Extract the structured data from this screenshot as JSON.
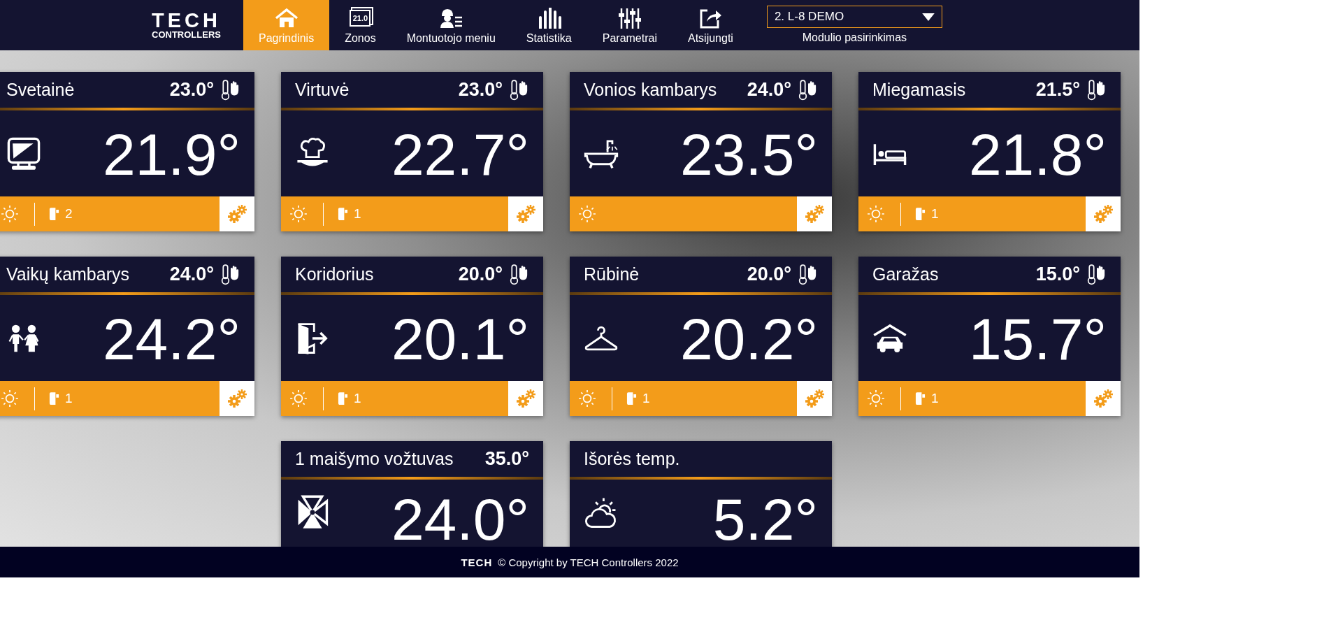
{
  "header": {
    "logo": {
      "brand": "TECH",
      "subtitle": "CONTROLLERS"
    },
    "nav": [
      {
        "label": "Pagrindinis",
        "kind": "home",
        "selected": true
      },
      {
        "label": "Zonos",
        "kind": "zones",
        "icon_text": "21.0",
        "selected": false
      },
      {
        "label": "Montuotojo meniu",
        "kind": "installer",
        "selected": false
      },
      {
        "label": "Statistika",
        "kind": "stats",
        "selected": false
      },
      {
        "label": "Parametrai",
        "kind": "sliders",
        "selected": false
      },
      {
        "label": "Atsijungti",
        "kind": "logout",
        "selected": false
      }
    ],
    "module_select": {
      "value": "2. L-8 DEMO",
      "label": "Modulio pasirinkimas"
    }
  },
  "rows": [
    {
      "cards": [
        {
          "name": "Svetainė",
          "setpoint": "23.0°",
          "manual": true,
          "temperature": "21.9°",
          "kind": "tv",
          "status_bar": {
            "heating": true,
            "count": "2"
          }
        },
        {
          "name": "Virtuvė",
          "setpoint": "23.0°",
          "manual": true,
          "temperature": "22.7°",
          "kind": "kitchen",
          "status_bar": {
            "heating": true,
            "count": "1"
          }
        },
        {
          "name": "Vonios kambarys",
          "setpoint": "24.0°",
          "manual": true,
          "temperature": "23.5°",
          "kind": "bath",
          "status_bar": {
            "heating": true
          }
        },
        {
          "name": "Miegamasis",
          "setpoint": "21.5°",
          "manual": true,
          "temperature": "21.8°",
          "kind": "bed",
          "status_bar": {
            "heating": true,
            "count": "1"
          }
        }
      ]
    },
    {
      "cards": [
        {
          "name": "Vaikų kambarys",
          "setpoint": "24.0°",
          "manual": true,
          "temperature": "24.2°",
          "kind": "kids",
          "status_bar": {
            "heating": true,
            "count": "1"
          }
        },
        {
          "name": "Koridorius",
          "setpoint": "20.0°",
          "manual": true,
          "temperature": "20.1°",
          "kind": "door",
          "status_bar": {
            "heating": true,
            "count": "1"
          }
        },
        {
          "name": "Rūbinė",
          "setpoint": "20.0°",
          "manual": true,
          "temperature": "20.2°",
          "kind": "hanger",
          "status_bar": {
            "heating": true,
            "count": "1"
          }
        },
        {
          "name": "Garažas",
          "setpoint": "15.0°",
          "manual": true,
          "temperature": "15.7°",
          "kind": "garage",
          "status_bar": {
            "heating": true,
            "count": "1"
          }
        }
      ]
    },
    {
      "cards": [
        {
          "name": "1 maišymo vožtuvas",
          "setpoint": "35.0°",
          "manual": false,
          "temperature": "24.0°",
          "kind": "valve"
        },
        {
          "name": "Išorės temp.",
          "manual": false,
          "temperature": "5.2°",
          "kind": "weather"
        }
      ]
    }
  ],
  "footer": {
    "brand": "TECH",
    "copyright": "© Copyright by TECH Controllers 2022"
  }
}
